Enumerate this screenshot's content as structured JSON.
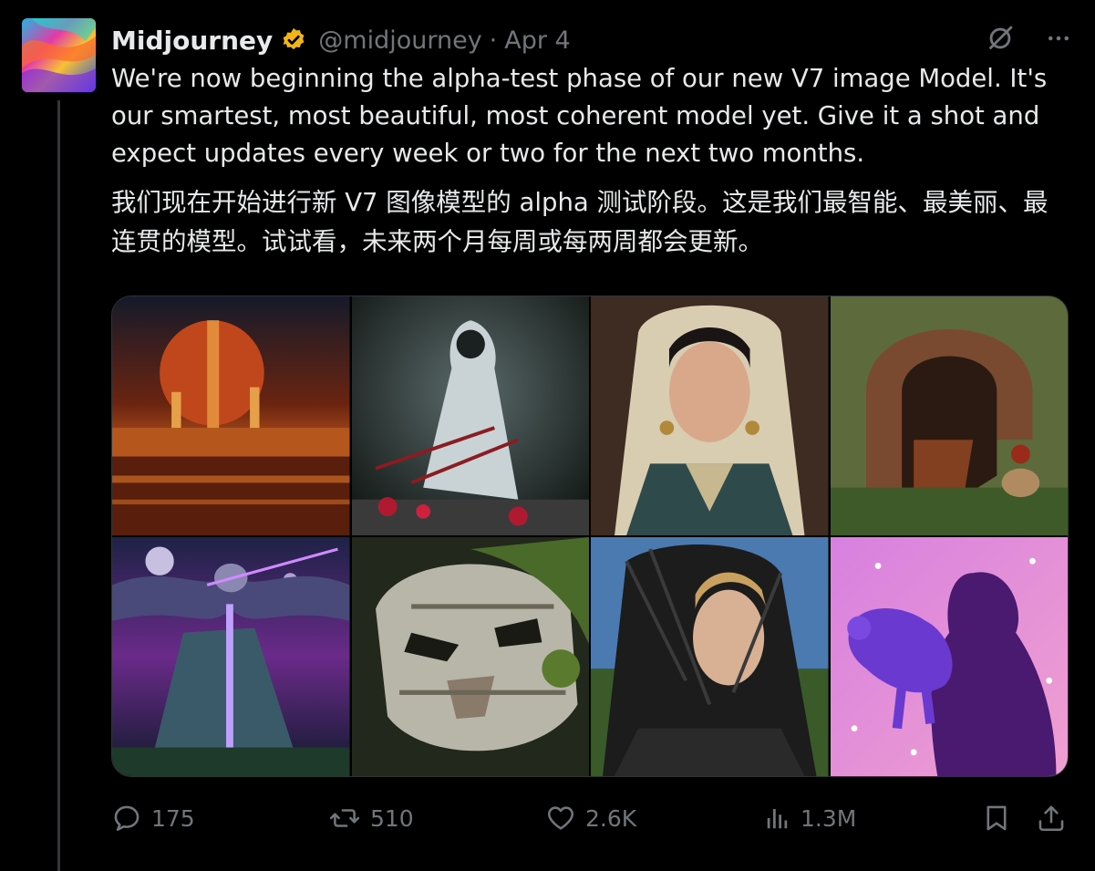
{
  "author": {
    "name": "Midjourney",
    "handle": "@midjourney",
    "separator": "·",
    "date": "Apr 4",
    "verified_color": "#f2b518"
  },
  "icons": {
    "header": [
      "grok-icon",
      "more-icon"
    ],
    "actions": [
      "reply-icon",
      "retweet-icon",
      "like-icon",
      "views-icon",
      "bookmark-icon",
      "share-icon"
    ]
  },
  "text_en": "We're now beginning the alpha-test phase of our new V7 image Model. It's our smartest, most beautiful, most coherent model yet. Give it a shot and expect updates every week or two for the next two months.",
  "text_zh": "我们现在开始进行新 V7 图像模型的 alpha 测试阶段。这是我们最智能、最美丽、最连贯的模型。试试看，未来两个月每周或每两周都会更新。",
  "media": [
    "retro sci-fi city at sunset by the water",
    "hooded white figure with swords",
    "portrait of a girl in traditional headdress",
    "stone arch ruins with a rider on horseback",
    "owl and moon over a mountain with a sword",
    "mechanical tiger head covered in moss",
    "young man with a knitted hood",
    "silhouette of a girl holding a purple leopard"
  ],
  "stats": {
    "replies": "175",
    "reposts": "510",
    "likes": "2.6K",
    "views": "1.3M"
  },
  "colors": {
    "background": "#000000",
    "text": "#e7e9ea",
    "muted": "#71767b"
  }
}
